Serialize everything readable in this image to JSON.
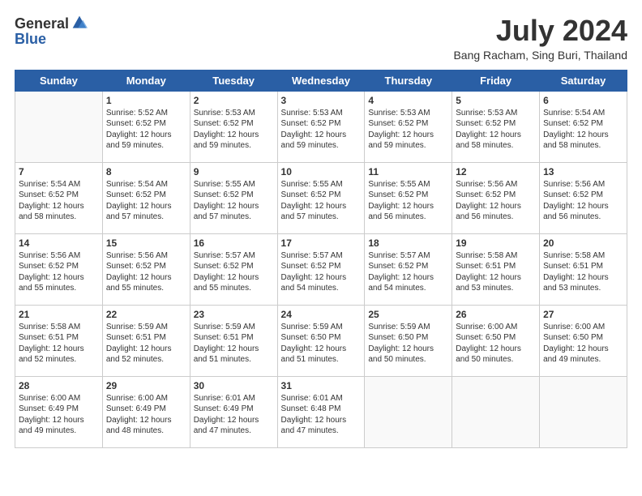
{
  "logo": {
    "general": "General",
    "blue": "Blue"
  },
  "title": "July 2024",
  "subtitle": "Bang Racham, Sing Buri, Thailand",
  "days_header": [
    "Sunday",
    "Monday",
    "Tuesday",
    "Wednesday",
    "Thursday",
    "Friday",
    "Saturday"
  ],
  "weeks": [
    [
      {
        "day": "",
        "content": ""
      },
      {
        "day": "1",
        "content": "Sunrise: 5:52 AM\nSunset: 6:52 PM\nDaylight: 12 hours\nand 59 minutes."
      },
      {
        "day": "2",
        "content": "Sunrise: 5:53 AM\nSunset: 6:52 PM\nDaylight: 12 hours\nand 59 minutes."
      },
      {
        "day": "3",
        "content": "Sunrise: 5:53 AM\nSunset: 6:52 PM\nDaylight: 12 hours\nand 59 minutes."
      },
      {
        "day": "4",
        "content": "Sunrise: 5:53 AM\nSunset: 6:52 PM\nDaylight: 12 hours\nand 59 minutes."
      },
      {
        "day": "5",
        "content": "Sunrise: 5:53 AM\nSunset: 6:52 PM\nDaylight: 12 hours\nand 58 minutes."
      },
      {
        "day": "6",
        "content": "Sunrise: 5:54 AM\nSunset: 6:52 PM\nDaylight: 12 hours\nand 58 minutes."
      }
    ],
    [
      {
        "day": "7",
        "content": "Sunrise: 5:54 AM\nSunset: 6:52 PM\nDaylight: 12 hours\nand 58 minutes."
      },
      {
        "day": "8",
        "content": "Sunrise: 5:54 AM\nSunset: 6:52 PM\nDaylight: 12 hours\nand 57 minutes."
      },
      {
        "day": "9",
        "content": "Sunrise: 5:55 AM\nSunset: 6:52 PM\nDaylight: 12 hours\nand 57 minutes."
      },
      {
        "day": "10",
        "content": "Sunrise: 5:55 AM\nSunset: 6:52 PM\nDaylight: 12 hours\nand 57 minutes."
      },
      {
        "day": "11",
        "content": "Sunrise: 5:55 AM\nSunset: 6:52 PM\nDaylight: 12 hours\nand 56 minutes."
      },
      {
        "day": "12",
        "content": "Sunrise: 5:56 AM\nSunset: 6:52 PM\nDaylight: 12 hours\nand 56 minutes."
      },
      {
        "day": "13",
        "content": "Sunrise: 5:56 AM\nSunset: 6:52 PM\nDaylight: 12 hours\nand 56 minutes."
      }
    ],
    [
      {
        "day": "14",
        "content": "Sunrise: 5:56 AM\nSunset: 6:52 PM\nDaylight: 12 hours\nand 55 minutes."
      },
      {
        "day": "15",
        "content": "Sunrise: 5:56 AM\nSunset: 6:52 PM\nDaylight: 12 hours\nand 55 minutes."
      },
      {
        "day": "16",
        "content": "Sunrise: 5:57 AM\nSunset: 6:52 PM\nDaylight: 12 hours\nand 55 minutes."
      },
      {
        "day": "17",
        "content": "Sunrise: 5:57 AM\nSunset: 6:52 PM\nDaylight: 12 hours\nand 54 minutes."
      },
      {
        "day": "18",
        "content": "Sunrise: 5:57 AM\nSunset: 6:52 PM\nDaylight: 12 hours\nand 54 minutes."
      },
      {
        "day": "19",
        "content": "Sunrise: 5:58 AM\nSunset: 6:51 PM\nDaylight: 12 hours\nand 53 minutes."
      },
      {
        "day": "20",
        "content": "Sunrise: 5:58 AM\nSunset: 6:51 PM\nDaylight: 12 hours\nand 53 minutes."
      }
    ],
    [
      {
        "day": "21",
        "content": "Sunrise: 5:58 AM\nSunset: 6:51 PM\nDaylight: 12 hours\nand 52 minutes."
      },
      {
        "day": "22",
        "content": "Sunrise: 5:59 AM\nSunset: 6:51 PM\nDaylight: 12 hours\nand 52 minutes."
      },
      {
        "day": "23",
        "content": "Sunrise: 5:59 AM\nSunset: 6:51 PM\nDaylight: 12 hours\nand 51 minutes."
      },
      {
        "day": "24",
        "content": "Sunrise: 5:59 AM\nSunset: 6:50 PM\nDaylight: 12 hours\nand 51 minutes."
      },
      {
        "day": "25",
        "content": "Sunrise: 5:59 AM\nSunset: 6:50 PM\nDaylight: 12 hours\nand 50 minutes."
      },
      {
        "day": "26",
        "content": "Sunrise: 6:00 AM\nSunset: 6:50 PM\nDaylight: 12 hours\nand 50 minutes."
      },
      {
        "day": "27",
        "content": "Sunrise: 6:00 AM\nSunset: 6:50 PM\nDaylight: 12 hours\nand 49 minutes."
      }
    ],
    [
      {
        "day": "28",
        "content": "Sunrise: 6:00 AM\nSunset: 6:49 PM\nDaylight: 12 hours\nand 49 minutes."
      },
      {
        "day": "29",
        "content": "Sunrise: 6:00 AM\nSunset: 6:49 PM\nDaylight: 12 hours\nand 48 minutes."
      },
      {
        "day": "30",
        "content": "Sunrise: 6:01 AM\nSunset: 6:49 PM\nDaylight: 12 hours\nand 47 minutes."
      },
      {
        "day": "31",
        "content": "Sunrise: 6:01 AM\nSunset: 6:48 PM\nDaylight: 12 hours\nand 47 minutes."
      },
      {
        "day": "",
        "content": ""
      },
      {
        "day": "",
        "content": ""
      },
      {
        "day": "",
        "content": ""
      }
    ]
  ]
}
